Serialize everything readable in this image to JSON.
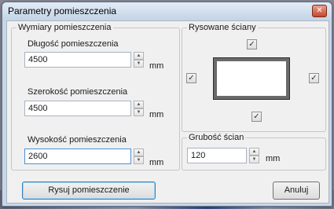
{
  "window": {
    "title": "Parametry pomieszczenia",
    "close_glyph": "✕"
  },
  "dimensions_group": {
    "legend": "Wymiary pomieszczenia",
    "length": {
      "label": "Długość pomieszczenia",
      "value": "4500",
      "unit": "mm"
    },
    "width": {
      "label": "Szerokość pomieszczenia",
      "value": "4500",
      "unit": "mm"
    },
    "height": {
      "label": "Wysokość pomieszczenia",
      "value": "2600",
      "unit": "mm"
    }
  },
  "walls_group": {
    "legend": "Rysowane ściany",
    "top_checked": "✓",
    "left_checked": "✓",
    "right_checked": "✓",
    "bottom_checked": "✓"
  },
  "thickness_group": {
    "legend": "Grubość ścian",
    "value": "120",
    "unit": "mm"
  },
  "spin_glyphs": {
    "up": "▲",
    "down": "▼"
  },
  "buttons": {
    "draw": "Rysuj pomieszczenie",
    "cancel": "Anuluj"
  },
  "colors": {
    "accent": "#3c7fb1",
    "close": "#c7452c"
  }
}
